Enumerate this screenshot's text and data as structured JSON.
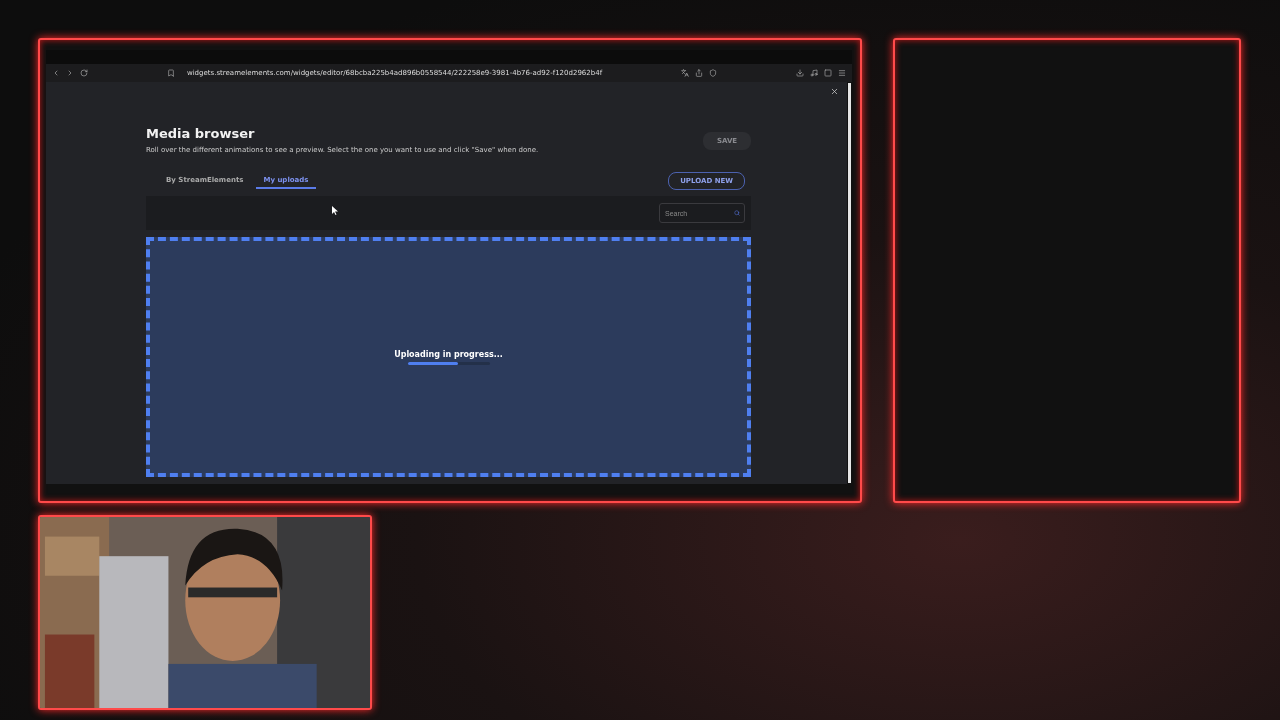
{
  "browser": {
    "url": "widgets.streamelements.com/widgets/editor/68bcba225b4ad896b0558544/222258e9-3981-4b76-ad92-f120d2962b4f"
  },
  "dialog": {
    "title": "Media browser",
    "description": "Roll over the different animations to see a preview. Select the one you want to use and click \"Save\" when done.",
    "save_button": {
      "label": "SAVE",
      "disabled": true
    },
    "tabs": [
      {
        "label": "By StreamElements",
        "selected": false
      },
      {
        "label": "My uploads",
        "selected": true
      }
    ],
    "upload_button": "UPLOAD NEW",
    "search": {
      "placeholder": "Search"
    },
    "dropzone": {
      "status": "Uploading in progress...",
      "level": 0.62
    }
  }
}
